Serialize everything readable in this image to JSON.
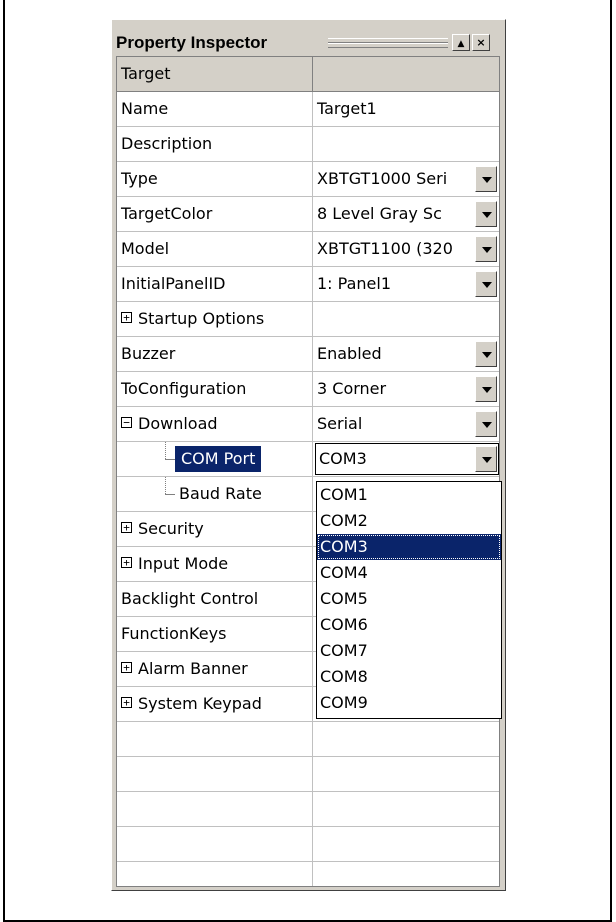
{
  "panel": {
    "title": "Property Inspector",
    "pin_glyph": "▲",
    "close_glyph": "×"
  },
  "grid": {
    "header": {
      "name": "Target",
      "value": ""
    },
    "rows": [
      {
        "name": "Name",
        "value": "Target1",
        "dropdown": false
      },
      {
        "name": "Description",
        "value": "",
        "dropdown": false
      },
      {
        "name": "Type",
        "value": "XBTGT1000 Seri",
        "dropdown": true
      },
      {
        "name": "TargetColor",
        "value": "8 Level Gray Sc",
        "dropdown": true
      },
      {
        "name": "Model",
        "value": "XBTGT1100 (320",
        "dropdown": true
      },
      {
        "name": "InitialPanelID",
        "value": "1: Panel1",
        "dropdown": true
      },
      {
        "name": "Startup Options",
        "value": "",
        "expander": "+"
      },
      {
        "name": "Buzzer",
        "value": "Enabled",
        "dropdown": true
      },
      {
        "name": "ToConfiguration",
        "value": "3 Corner",
        "dropdown": true
      },
      {
        "name": "Download",
        "value": "Serial",
        "dropdown": true,
        "expander": "−"
      },
      {
        "name": "COM Port",
        "value": "COM3",
        "dropdown": true,
        "selected": true
      },
      {
        "name": "Baud Rate",
        "value": ""
      },
      {
        "name": "Security",
        "value": "",
        "expander": "+"
      },
      {
        "name": "Input Mode",
        "value": "",
        "expander": "+"
      },
      {
        "name": "Backlight Control",
        "value": ""
      },
      {
        "name": "FunctionKeys",
        "value": ""
      },
      {
        "name": "Alarm Banner",
        "value": "",
        "expander": "+"
      },
      {
        "name": "System Keypad",
        "value": "",
        "expander": "+"
      }
    ]
  },
  "dropdown": {
    "selected": "COM3",
    "options": [
      "COM1",
      "COM2",
      "COM3",
      "COM4",
      "COM5",
      "COM6",
      "COM7",
      "COM8",
      "COM9"
    ]
  },
  "colors": {
    "selection": "#0a246a",
    "face": "#d4d0c8"
  }
}
